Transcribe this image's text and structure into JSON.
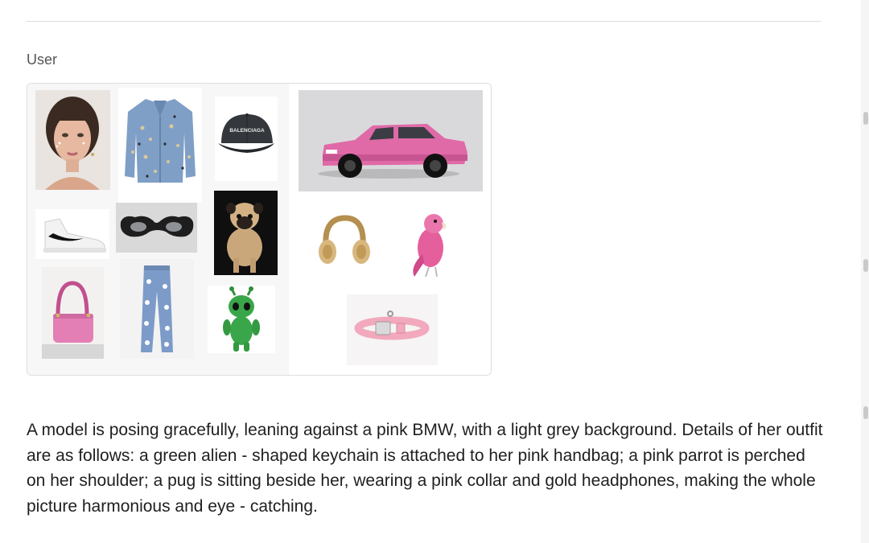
{
  "message": {
    "role": "User",
    "text": "A model is posing gracefully, leaning against a pink BMW, with a light grey background. Details of her outfit are as follows: a green alien - shaped keychain is attached to her pink handbag; a pink parrot is perched on her shoulder; a pug is sitting beside her, wearing a pink collar and gold headphones, making the whole picture harmonious and eye - catching."
  },
  "image_grid": {
    "cap_brand_text": "BALENCIAGA",
    "items": [
      {
        "icon": "model-portrait-image"
      },
      {
        "icon": "embellished-denim-jacket-image"
      },
      {
        "icon": "black-baseball-cap-image"
      },
      {
        "icon": "pink-bmw-car-image"
      },
      {
        "icon": "white-sneaker-image"
      },
      {
        "icon": "black-sunglasses-image"
      },
      {
        "icon": "pug-dog-image"
      },
      {
        "icon": "gold-headphones-image"
      },
      {
        "icon": "pink-parrot-image"
      },
      {
        "icon": "pink-handbag-image"
      },
      {
        "icon": "floral-jeans-image"
      },
      {
        "icon": "green-alien-keychain-image"
      },
      {
        "icon": "pink-dog-collar-image"
      }
    ]
  },
  "colors": {
    "text": "#1f1f1f",
    "label": "#555555",
    "divider": "#dcdcdc",
    "accent_pink": "#e06aa8"
  }
}
